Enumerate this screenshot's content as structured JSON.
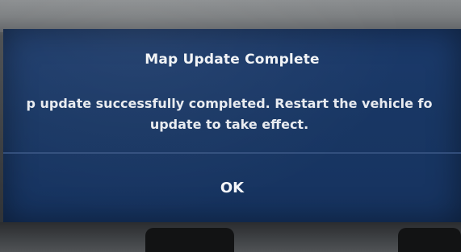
{
  "dialog": {
    "title": "Map Update Complete",
    "message_line1": "p update successfully completed. Restart the vehicle fo",
    "message_line2": "update to take effect.",
    "ok_label": "OK"
  },
  "colors": {
    "screen_background": "#183663",
    "text": "#f1f3f6",
    "divider": "#3a5685"
  }
}
